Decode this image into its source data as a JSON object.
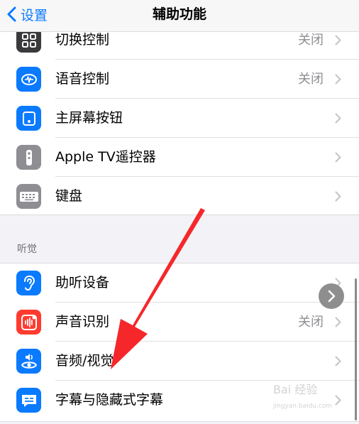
{
  "navbar": {
    "back_label": "设置",
    "title": "辅助功能"
  },
  "group1": [
    {
      "label": "切换控制",
      "value": "关闭",
      "icon": "switch-control-icon",
      "color": "#3a3a3c"
    },
    {
      "label": "语音控制",
      "value": "关闭",
      "icon": "voice-control-icon",
      "color": "#0a7aff"
    },
    {
      "label": "主屏幕按钮",
      "value": "",
      "icon": "home-button-icon",
      "color": "#0a7aff"
    },
    {
      "label": "Apple TV遥控器",
      "value": "",
      "icon": "tv-remote-icon",
      "color": "#8e8e93"
    },
    {
      "label": "键盘",
      "value": "",
      "icon": "keyboard-icon",
      "color": "#8e8e93"
    }
  ],
  "section_hearing": {
    "header": "听觉"
  },
  "group2": [
    {
      "label": "助听设备",
      "value": "",
      "icon": "hearing-aid-icon",
      "color": "#0a7aff"
    },
    {
      "label": "声音识别",
      "value": "关闭",
      "icon": "sound-recognition-icon",
      "color": "#ff3b30"
    },
    {
      "label": "音频/视觉",
      "value": "",
      "icon": "audio-visual-icon",
      "color": "#0a7aff"
    },
    {
      "label": "字幕与隐藏式字幕",
      "value": "",
      "icon": "subtitles-icon",
      "color": "#0a7aff"
    }
  ],
  "annotation": {
    "arrow_color": "#f5272a"
  },
  "watermark": {
    "text": "Bai 经验",
    "sub": "jingyan.baidu.com"
  }
}
